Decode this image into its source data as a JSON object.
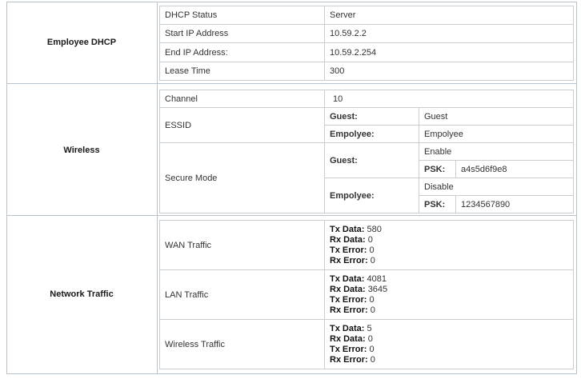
{
  "sections": {
    "employee_dhcp": {
      "title": "Employee DHCP",
      "rows": [
        {
          "label": "DHCP Status",
          "value": "Server"
        },
        {
          "label": "Start IP Address",
          "value": "10.59.2.2"
        },
        {
          "label": "End IP Address:",
          "value": "10.59.2.254"
        },
        {
          "label": "Lease Time",
          "value": "300"
        }
      ]
    },
    "wireless": {
      "title": "Wireless",
      "channel": {
        "label": "Channel",
        "value": "10"
      },
      "essid": {
        "label": "ESSID",
        "guest_label": "Guest:",
        "guest_value": "Guest",
        "employee_label": "Empolyee:",
        "employee_value": "Empolyee"
      },
      "secure_mode": {
        "label": "Secure Mode",
        "guest_label": "Guest:",
        "guest_state": "Enable",
        "guest_psk_label": "PSK:",
        "guest_psk_value": "a4s5d6f9e8",
        "employee_label": "Empolyee:",
        "employee_state": "Disable",
        "employee_psk_label": "PSK:",
        "employee_psk_value": "1234567890"
      }
    },
    "network_traffic": {
      "title": "Network Traffic",
      "stat_labels": {
        "tx_data": "Tx Data:",
        "rx_data": "Rx Data:",
        "tx_error": "Tx Error:",
        "rx_error": "Rx Error:"
      },
      "rows": [
        {
          "label": "WAN Traffic",
          "tx_data": "580",
          "rx_data": "0",
          "tx_error": "0",
          "rx_error": "0"
        },
        {
          "label": "LAN Traffic",
          "tx_data": "4081",
          "rx_data": "3645",
          "tx_error": "0",
          "rx_error": "0"
        },
        {
          "label": "Wireless Traffic",
          "tx_data": "5",
          "rx_data": "0",
          "tx_error": "0",
          "rx_error": "0"
        }
      ]
    }
  }
}
